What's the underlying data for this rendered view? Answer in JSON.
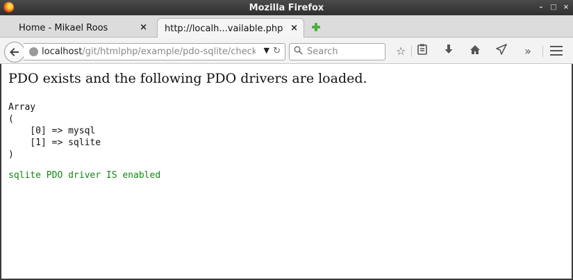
{
  "window": {
    "title": "Mozilla Firefox"
  },
  "tabs": [
    {
      "label": "Home - Mikael Roos",
      "close": "×",
      "active": false
    },
    {
      "label": "http://localh...vailable.php",
      "close": "×",
      "active": true
    }
  ],
  "navbar": {
    "url_host": "localhost",
    "url_path": "/git/htmlphp/example/pdo-sqlite/check",
    "search_placeholder": "Search"
  },
  "content": {
    "heading": "PDO exists and the following PDO drivers are loaded.",
    "array_lines": [
      "Array",
      "(",
      "    [0] => mysql",
      "    [1] => sqlite",
      ")"
    ],
    "status": "sqlite PDO driver IS enabled"
  },
  "colors": {
    "status_text": "#118811",
    "newtab_plus": "#4caf3a"
  },
  "icons": {
    "back": "back-arrow-icon",
    "globe": "globe-icon",
    "reload": "reload-icon",
    "search": "search-icon",
    "bookmark": "star-icon",
    "reading_list": "clipboard-icon",
    "downloads": "download-arrow-icon",
    "home": "home-icon",
    "send": "send-icon",
    "overflow": "chevron-double-right-icon",
    "menu": "hamburger-menu-icon"
  }
}
